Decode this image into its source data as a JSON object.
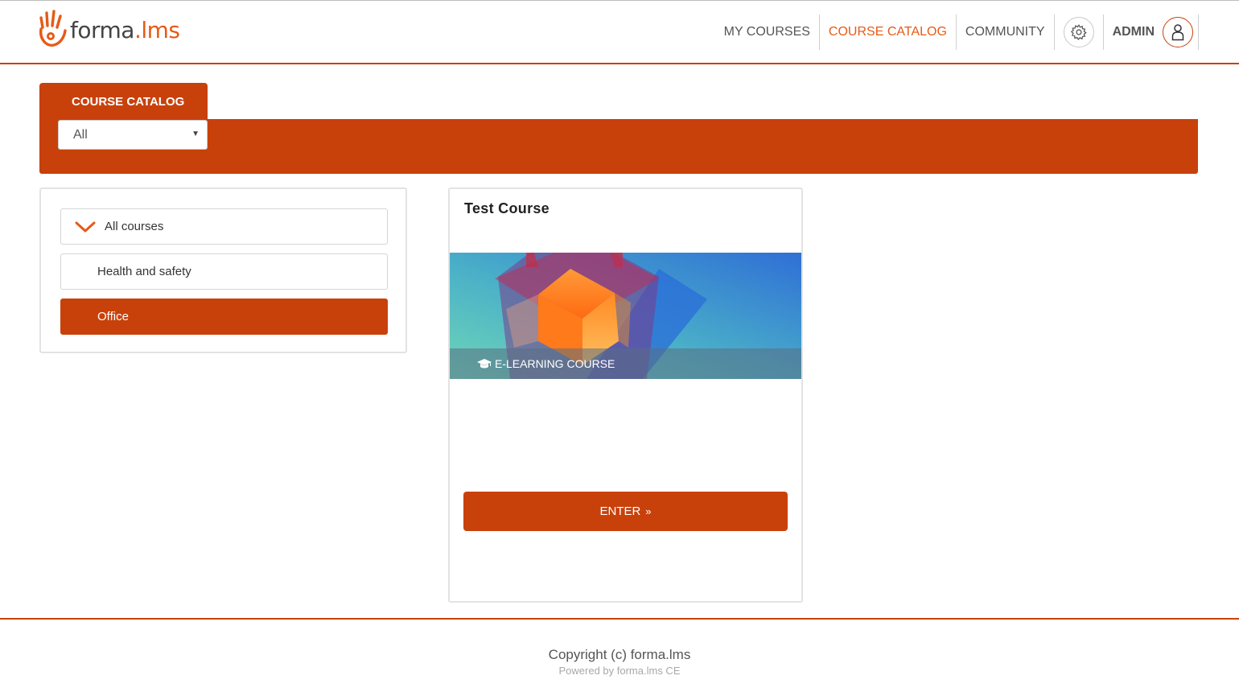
{
  "brand": {
    "name_main": "forma",
    "name_accent": ".lms",
    "accent_color": "#e65a16",
    "primary_color": "#c8410b"
  },
  "nav": {
    "items": [
      {
        "label": "MY COURSES",
        "active": false
      },
      {
        "label": "COURSE CATALOG",
        "active": true
      },
      {
        "label": "COMMUNITY",
        "active": false
      }
    ],
    "settings_icon": "gear-icon",
    "user_label": "ADMIN",
    "user_icon": "user-icon"
  },
  "catalog": {
    "tab_label": "COURSE CATALOG",
    "filter_selected": "All"
  },
  "categories": [
    {
      "label": "All courses",
      "expanded": true
    },
    {
      "label": "Health and safety",
      "selected": false
    },
    {
      "label": "Office",
      "selected": true
    }
  ],
  "course": {
    "title": "Test Course",
    "type_label": "E-LEARNING COURSE",
    "enter_label": "ENTER"
  },
  "footer": {
    "copyright": "Copyright (c) forma.lms",
    "powered": "Powered by forma.lms CE"
  }
}
